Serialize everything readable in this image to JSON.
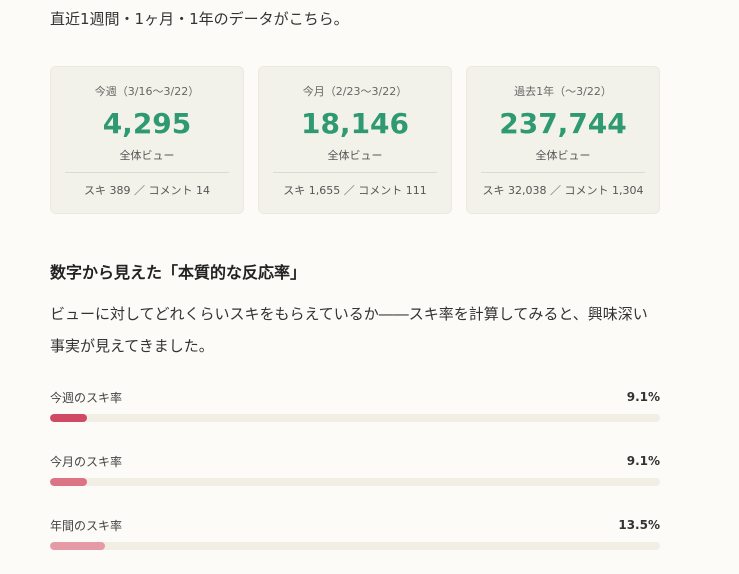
{
  "intro": "直近1週間・1ヶ月・1年のデータがこちら。",
  "cards": [
    {
      "period": "今週（3/16〜3/22）",
      "number": "4,295",
      "unit": "全体ビュー",
      "stats": "スキ 389 ／ コメント 14"
    },
    {
      "period": "今月（2/23〜3/22）",
      "number": "18,146",
      "unit": "全体ビュー",
      "stats": "スキ 1,655 ／ コメント 111"
    },
    {
      "period": "過去1年（〜3/22）",
      "number": "237,744",
      "unit": "全体ビュー",
      "stats": "スキ 32,038 ／ コメント 1,304"
    }
  ],
  "section_title": "数字から見えた「本質的な反応率」",
  "paragraph": "ビューに対してどれくらいスキをもらえているか――スキ率を計算してみると、興味深い事実が見えてきました。",
  "rates": [
    {
      "label": "今週のスキ率",
      "value_text": "9.1%",
      "fraction": 0.091,
      "color": "#d14a63"
    },
    {
      "label": "今月のスキ率",
      "value_text": "9.1%",
      "fraction": 0.091,
      "color": "#dc7485"
    },
    {
      "label": "年間のスキ率",
      "value_text": "13.5%",
      "fraction": 0.135,
      "color": "#e69aa6"
    }
  ],
  "colors": {
    "accent_green": "#2f9a72",
    "card_bg": "#f3f2ea",
    "page_bg": "#fcfbf7"
  }
}
